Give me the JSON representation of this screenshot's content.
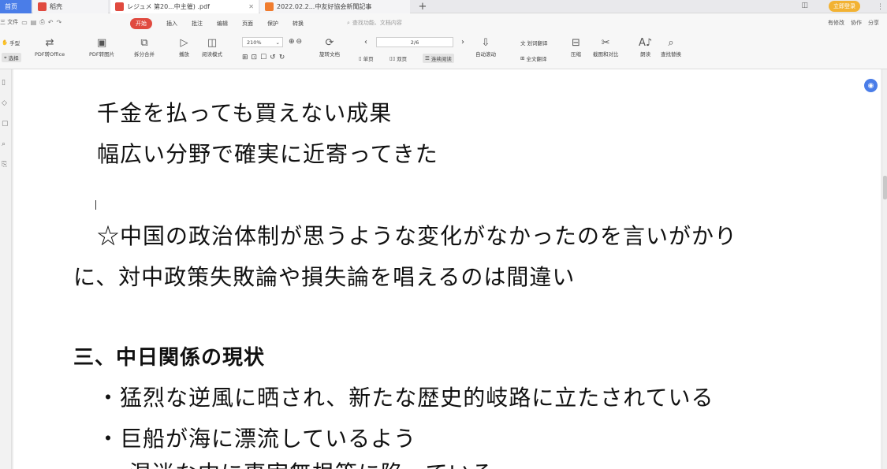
{
  "tabs": {
    "home": "首页",
    "daoke": "稻壳",
    "active_doc": "レジュメ 第20...中主催) .pdf",
    "second_doc": "2022.02.2...中友好協会新聞記事",
    "add": "+"
  },
  "titlebar": {
    "login_label": "立即登录"
  },
  "menu": {
    "file": "三 文件",
    "tabs": [
      "开始",
      "插入",
      "批注",
      "编辑",
      "页面",
      "保护",
      "转换"
    ],
    "active_tab": "开始",
    "search_placeholder": "查找功能、文档内容",
    "right": [
      "有修改",
      "协作",
      "分享"
    ]
  },
  "ribbon": {
    "hand": "手型",
    "select": "选择",
    "pdf_to_office": "PDF转Office",
    "pdf_to_image": "PDF转图片",
    "split_merge": "拆分合并",
    "play": "播放",
    "read_mode": "阅读模式",
    "zoom": "210%",
    "rotate": "旋转文档",
    "single_page": "单页",
    "double_page": "双页",
    "continuous": "连续阅读",
    "page_indicator": "2/6",
    "auto_scroll": "自动滚动",
    "translate_selection": "划词翻译",
    "full_translate": "全文翻译",
    "compress": "压缩",
    "screenshot_compare": "截图和对比",
    "read_aloud": "朗读",
    "find_replace": "查找替换"
  },
  "document": {
    "lines": [
      "千金を払っても買えない成果",
      "幅広い分野で確実に近寄ってきた",
      "☆中国の政治体制が思うような変化がなかったのを言いがかり",
      "に、対中政策失敗論や損失論を唱えるのは間違い"
    ],
    "heading": "三、中日関係の現状",
    "bullets": [
      "・猛烈な逆風に晒され、新たな歴史的岐路に立たされている",
      "・巨船が海に漂流しているよう",
      "・混迷な中に事実無根等に陥っている"
    ]
  }
}
